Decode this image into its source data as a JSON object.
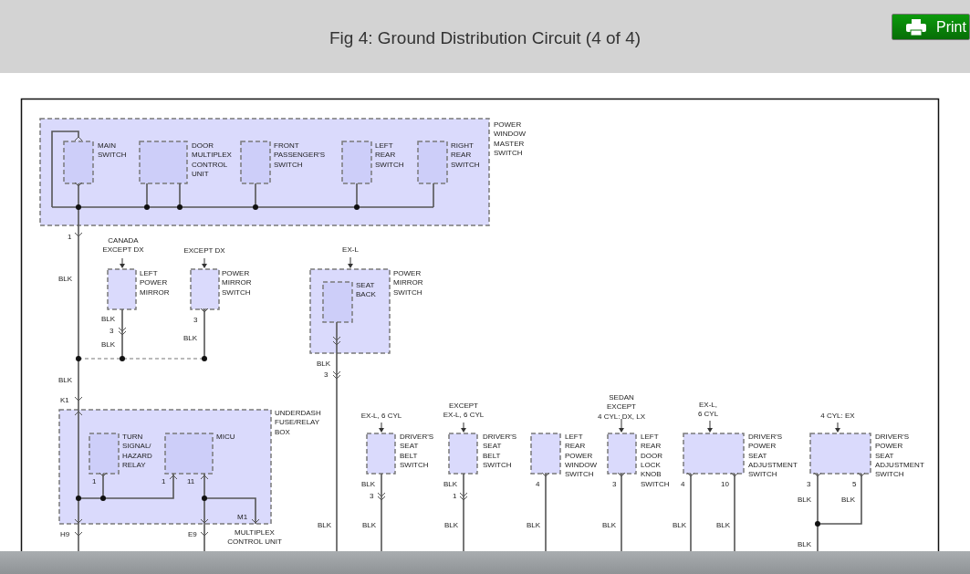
{
  "header": {
    "title": "Fig 4: Ground Distribution Circuit (4 of 4)",
    "print_button": "Print"
  },
  "diagram": {
    "component_labels": [
      {
        "lines": [
          "MAIN",
          "SWITCH"
        ]
      },
      {
        "lines": [
          "DOOR",
          "MULTIPLEX",
          "CONTROL",
          "UNIT"
        ]
      },
      {
        "lines": [
          "FRONT",
          "PASSENGER'S",
          "SWITCH"
        ]
      },
      {
        "lines": [
          "LEFT",
          "REAR",
          "SWITCH"
        ]
      },
      {
        "lines": [
          "RIGHT",
          "REAR",
          "SWITCH"
        ]
      },
      {
        "lines": [
          "POWER",
          "WINDOW",
          "MASTER",
          "SWITCH"
        ]
      },
      {
        "lines": [
          "LEFT",
          "POWER",
          "MIRROR"
        ]
      },
      {
        "lines": [
          "POWER",
          "MIRROR",
          "SWITCH"
        ]
      },
      {
        "lines": [
          "SEAT",
          "BACK"
        ]
      },
      {
        "lines": [
          "POWER",
          "MIRROR",
          "SWITCH"
        ]
      },
      {
        "lines": [
          "UNDERDASH",
          "FUSE/RELAY",
          "BOX"
        ]
      },
      {
        "lines": [
          "TURN",
          "SIGNAL/",
          "HAZARD",
          "RELAY"
        ]
      },
      {
        "lines": [
          "MICU"
        ]
      },
      {
        "lines": [
          "DRIVER'S",
          "SEAT",
          "BELT",
          "SWITCH"
        ]
      },
      {
        "lines": [
          "DRIVER'S",
          "SEAT",
          "BELT",
          "SWITCH"
        ]
      },
      {
        "lines": [
          "LEFT",
          "REAR",
          "POWER",
          "WINDOW",
          "SWITCH"
        ]
      },
      {
        "lines": [
          "LEFT",
          "REAR",
          "DOOR",
          "LOCK",
          "KNOB",
          "SWITCH"
        ]
      },
      {
        "lines": [
          "DRIVER'S",
          "POWER",
          "SEAT",
          "ADJUSTMENT",
          "SWITCH"
        ]
      },
      {
        "lines": [
          "DRIVER'S",
          "POWER",
          "SEAT",
          "ADJUSTMENT",
          "SWITCH"
        ]
      },
      {
        "lines": [
          "MULTIPLEX",
          "CONTROL UNIT"
        ]
      }
    ],
    "condition_notes": [
      {
        "lines": [
          "CANADA",
          "EXCEPT DX"
        ]
      },
      {
        "lines": [
          "EXCEPT DX"
        ]
      },
      {
        "lines": [
          "EX-L"
        ]
      },
      {
        "lines": [
          "EX-L, 6 CYL"
        ]
      },
      {
        "lines": [
          "EXCEPT",
          "EX-L, 6 CYL"
        ]
      },
      {
        "lines": [
          "SEDAN",
          "EXCEPT",
          "4 CYL: DX, LX"
        ]
      },
      {
        "lines": [
          "EX-L,",
          "6 CYL"
        ]
      },
      {
        "lines": [
          "4 CYL: EX"
        ]
      }
    ],
    "pin_numbers": [
      "1",
      "3",
      "3",
      "3",
      "K1",
      "1",
      "1",
      "11",
      "M1",
      "H9",
      "E9",
      "3",
      "1",
      "4",
      "3",
      "4",
      "10",
      "3",
      "5"
    ],
    "wire_labels": [
      "BLK",
      "BLK",
      "BLK",
      "BLK",
      "BLK",
      "BLK",
      "BLK",
      "BLK",
      "BLK",
      "BLK",
      "BLK",
      "BLK",
      "BLK",
      "BLK",
      "BLK",
      "BLK",
      "BLK",
      "BLK"
    ]
  }
}
